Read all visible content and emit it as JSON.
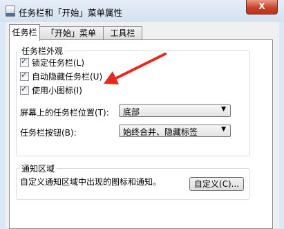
{
  "window": {
    "title": "任务栏和「开始」菜单属性",
    "close_glyph": "X"
  },
  "tabs": [
    {
      "label": "任务栏"
    },
    {
      "label": "「开始」菜单"
    },
    {
      "label": "工具栏"
    }
  ],
  "appearance": {
    "title": "任务栏外观",
    "lock_label": "锁定任务栏(L)",
    "lock_checked": true,
    "autohide_label": "自动隐藏任务栏(U)",
    "autohide_checked": true,
    "small_icons_label": "使用小图标(I)",
    "small_icons_checked": true,
    "position_label": "屏幕上的任务栏位置(T):",
    "position_value": "底部",
    "buttons_label": "任务栏按钮(B):",
    "buttons_value": "始终合并、隐藏标签"
  },
  "notification": {
    "title": "通知区域",
    "description": "自定义通知区域中出现的图标和通知。",
    "customize_label": "自定义(C)..."
  },
  "annotation": {
    "arrow_color": "#e8281b"
  },
  "glyphs": {
    "check": "✓",
    "dropdown": "▼"
  }
}
